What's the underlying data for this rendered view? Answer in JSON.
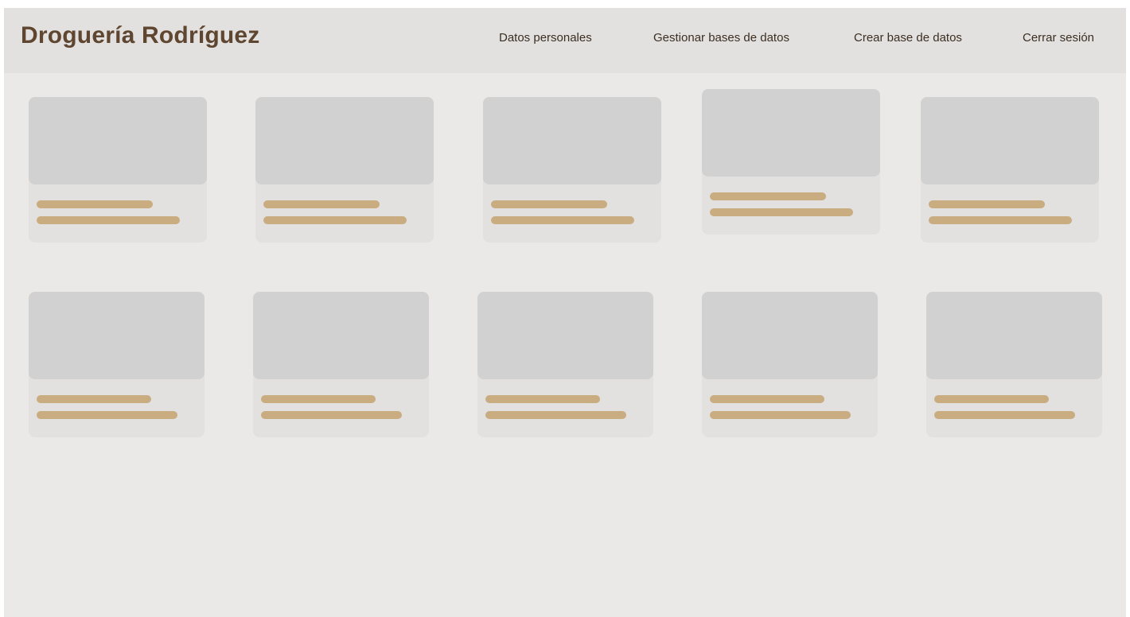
{
  "header": {
    "brand": "Droguería Rodríguez",
    "nav": [
      {
        "label": "Datos personales"
      },
      {
        "label": "Gestionar bases de datos"
      },
      {
        "label": "Crear base de datos"
      },
      {
        "label": "Cerrar sesión"
      }
    ]
  },
  "colors": {
    "brand_text": "#5e4630",
    "placeholder_bar": "#c9ac80",
    "placeholder_thumb": "#d1d1d1",
    "card_background": "#e3e1df",
    "page_background": "#ebe9e7"
  },
  "main": {
    "cards_state": "loading-skeleton",
    "card_count": 10
  }
}
